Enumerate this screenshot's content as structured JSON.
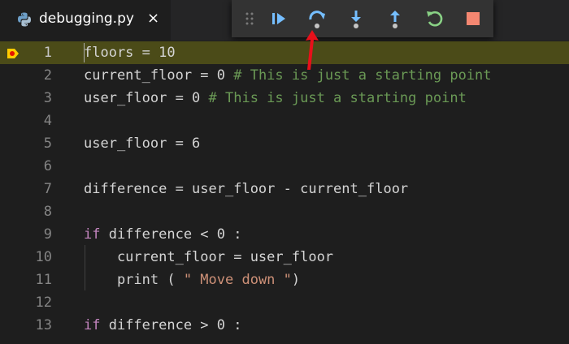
{
  "tab": {
    "title": "debugging.py",
    "close_glyph": "×",
    "icon": "python-icon"
  },
  "debug_toolbar": {
    "buttons": [
      {
        "name": "continue-button",
        "icon": "continue-icon",
        "color": "#75beff"
      },
      {
        "name": "step-over-button",
        "icon": "step-over-icon",
        "color": "#75beff"
      },
      {
        "name": "step-into-button",
        "icon": "step-into-icon",
        "color": "#75beff"
      },
      {
        "name": "step-out-button",
        "icon": "step-out-icon",
        "color": "#75beff"
      },
      {
        "name": "restart-button",
        "icon": "restart-icon",
        "color": "#89d185"
      },
      {
        "name": "stop-button",
        "icon": "stop-icon",
        "color": "#f48771"
      }
    ]
  },
  "editor": {
    "current_line": 1,
    "lines": [
      {
        "num": "1",
        "tokens": [
          {
            "t": "floors = 10",
            "c": ""
          }
        ]
      },
      {
        "num": "2",
        "tokens": [
          {
            "t": "current_floor = 0 ",
            "c": ""
          },
          {
            "t": "# This is just a starting point",
            "c": "cm"
          }
        ]
      },
      {
        "num": "3",
        "tokens": [
          {
            "t": "user_floor = 0 ",
            "c": ""
          },
          {
            "t": "# This is just a starting point",
            "c": "cm"
          }
        ]
      },
      {
        "num": "4",
        "tokens": []
      },
      {
        "num": "5",
        "tokens": [
          {
            "t": "user_floor = 6",
            "c": ""
          }
        ]
      },
      {
        "num": "6",
        "tokens": []
      },
      {
        "num": "7",
        "tokens": [
          {
            "t": "difference = user_floor - current_floor",
            "c": ""
          }
        ]
      },
      {
        "num": "8",
        "tokens": []
      },
      {
        "num": "9",
        "tokens": [
          {
            "t": "if",
            "c": "kw"
          },
          {
            "t": " difference < 0 :",
            "c": ""
          }
        ]
      },
      {
        "num": "10",
        "tokens": [
          {
            "t": "    current_floor = user_floor",
            "c": ""
          }
        ]
      },
      {
        "num": "11",
        "tokens": [
          {
            "t": "    print ( ",
            "c": ""
          },
          {
            "t": "\" Move down \"",
            "c": "str"
          },
          {
            "t": ")",
            "c": ""
          }
        ]
      },
      {
        "num": "12",
        "tokens": []
      },
      {
        "num": "13",
        "tokens": [
          {
            "t": "if",
            "c": "kw"
          },
          {
            "t": " difference > 0 :",
            "c": ""
          }
        ]
      }
    ]
  },
  "annotation": {
    "icon": "red-arrow-icon",
    "color": "#e8101a"
  }
}
